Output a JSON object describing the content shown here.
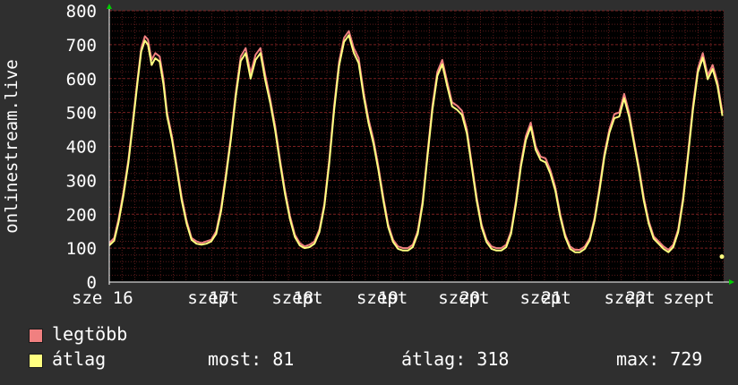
{
  "chart_data": {
    "type": "line",
    "ylabel": "onlinestream.live",
    "ylim": [
      0,
      800
    ],
    "yticks": [
      0,
      100,
      200,
      300,
      400,
      500,
      600,
      700,
      800
    ],
    "xlim": [
      0,
      100
    ],
    "xticks": [
      {
        "x": 3.6,
        "label": "sze 16"
      },
      {
        "x": 16.9,
        "label": "szept"
      },
      {
        "x": 17.9,
        "label": "17"
      },
      {
        "x": 30.6,
        "label": "szept"
      },
      {
        "x": 31.6,
        "label": "18"
      },
      {
        "x": 44.4,
        "label": "szept"
      },
      {
        "x": 45.4,
        "label": "19"
      },
      {
        "x": 57.7,
        "label": "szept"
      },
      {
        "x": 58.7,
        "label": "20"
      },
      {
        "x": 71.0,
        "label": "szept"
      },
      {
        "x": 72.0,
        "label": "21"
      },
      {
        "x": 84.7,
        "label": "szept"
      },
      {
        "x": 85.7,
        "label": "22"
      },
      {
        "x": 98.5,
        "label": "szept"
      }
    ],
    "grid": true,
    "colors": {
      "background": "#000000",
      "outer": "#2f2f2f",
      "grid": "#5a1a1a",
      "axis": "#ffffff",
      "max_series": "#f08080",
      "avg_series": "#ffff80",
      "arrow": "#00cc00"
    },
    "series": [
      {
        "name": "legtöbb",
        "color": "#f08080",
        "points": [
          [
            0,
            115
          ],
          [
            0.8,
            130
          ],
          [
            1.5,
            185
          ],
          [
            2.3,
            265
          ],
          [
            3.1,
            360
          ],
          [
            3.8,
            470
          ],
          [
            4.6,
            600
          ],
          [
            5.2,
            690
          ],
          [
            5.8,
            725
          ],
          [
            6.3,
            715
          ],
          [
            6.9,
            655
          ],
          [
            7.5,
            675
          ],
          [
            8.2,
            665
          ],
          [
            8.8,
            600
          ],
          [
            9.4,
            500
          ],
          [
            10.2,
            430
          ],
          [
            11,
            340
          ],
          [
            11.8,
            250
          ],
          [
            12.6,
            180
          ],
          [
            13.4,
            130
          ],
          [
            14.2,
            120
          ],
          [
            15,
            115
          ],
          [
            15.8,
            120
          ],
          [
            16.6,
            125
          ],
          [
            17.4,
            150
          ],
          [
            18.2,
            220
          ],
          [
            19,
            320
          ],
          [
            19.8,
            430
          ],
          [
            20.6,
            560
          ],
          [
            21.4,
            665
          ],
          [
            22.2,
            690
          ],
          [
            23,
            615
          ],
          [
            23.8,
            670
          ],
          [
            24.6,
            690
          ],
          [
            25.4,
            610
          ],
          [
            26.2,
            540
          ],
          [
            27,
            460
          ],
          [
            27.8,
            360
          ],
          [
            28.6,
            270
          ],
          [
            29.4,
            195
          ],
          [
            30.2,
            140
          ],
          [
            31,
            115
          ],
          [
            31.8,
            105
          ],
          [
            32.6,
            110
          ],
          [
            33.4,
            120
          ],
          [
            34.2,
            155
          ],
          [
            35,
            230
          ],
          [
            35.8,
            360
          ],
          [
            36.6,
            520
          ],
          [
            37.4,
            650
          ],
          [
            38.2,
            720
          ],
          [
            39,
            740
          ],
          [
            39.8,
            690
          ],
          [
            40.6,
            660
          ],
          [
            41.4,
            560
          ],
          [
            42.2,
            480
          ],
          [
            43,
            420
          ],
          [
            43.8,
            340
          ],
          [
            44.6,
            250
          ],
          [
            45.4,
            170
          ],
          [
            46.2,
            125
          ],
          [
            47,
            105
          ],
          [
            47.8,
            100
          ],
          [
            48.6,
            100
          ],
          [
            49.4,
            110
          ],
          [
            50.2,
            150
          ],
          [
            51,
            240
          ],
          [
            51.8,
            380
          ],
          [
            52.6,
            520
          ],
          [
            53.4,
            620
          ],
          [
            54.2,
            655
          ],
          [
            55,
            590
          ],
          [
            55.8,
            530
          ],
          [
            56.6,
            520
          ],
          [
            57.4,
            505
          ],
          [
            58.2,
            450
          ],
          [
            59,
            350
          ],
          [
            59.8,
            250
          ],
          [
            60.6,
            170
          ],
          [
            61.4,
            125
          ],
          [
            62.2,
            105
          ],
          [
            63,
            100
          ],
          [
            63.8,
            100
          ],
          [
            64.6,
            110
          ],
          [
            65.4,
            150
          ],
          [
            66.2,
            240
          ],
          [
            67,
            350
          ],
          [
            67.8,
            430
          ],
          [
            68.6,
            470
          ],
          [
            69.4,
            400
          ],
          [
            70.2,
            370
          ],
          [
            71,
            365
          ],
          [
            71.8,
            330
          ],
          [
            72.6,
            280
          ],
          [
            73.4,
            200
          ],
          [
            74.2,
            140
          ],
          [
            75,
            105
          ],
          [
            75.8,
            95
          ],
          [
            76.6,
            95
          ],
          [
            77.4,
            105
          ],
          [
            78.2,
            130
          ],
          [
            79,
            190
          ],
          [
            79.8,
            280
          ],
          [
            80.6,
            380
          ],
          [
            81.4,
            450
          ],
          [
            82.2,
            495
          ],
          [
            83,
            500
          ],
          [
            83.8,
            555
          ],
          [
            84.6,
            500
          ],
          [
            85.4,
            420
          ],
          [
            86.2,
            340
          ],
          [
            87,
            250
          ],
          [
            87.8,
            180
          ],
          [
            88.6,
            135
          ],
          [
            89.4,
            120
          ],
          [
            90.2,
            105
          ],
          [
            91,
            95
          ],
          [
            91.8,
            110
          ],
          [
            92.6,
            155
          ],
          [
            93.4,
            250
          ],
          [
            94.2,
            380
          ],
          [
            95,
            520
          ],
          [
            95.8,
            630
          ],
          [
            96.6,
            675
          ],
          [
            97.4,
            610
          ],
          [
            98.2,
            640
          ],
          [
            99,
            590
          ],
          [
            99.8,
            500
          ]
        ]
      },
      {
        "name": "átlag",
        "color": "#ffff80",
        "points": [
          [
            0,
            108
          ],
          [
            0.8,
            122
          ],
          [
            1.5,
            175
          ],
          [
            2.3,
            255
          ],
          [
            3.1,
            350
          ],
          [
            3.8,
            460
          ],
          [
            4.6,
            590
          ],
          [
            5.2,
            680
          ],
          [
            5.8,
            712
          ],
          [
            6.3,
            700
          ],
          [
            6.9,
            640
          ],
          [
            7.5,
            660
          ],
          [
            8.2,
            650
          ],
          [
            8.8,
            585
          ],
          [
            9.4,
            490
          ],
          [
            10.2,
            420
          ],
          [
            11,
            330
          ],
          [
            11.8,
            240
          ],
          [
            12.6,
            172
          ],
          [
            13.4,
            124
          ],
          [
            14.2,
            113
          ],
          [
            15,
            110
          ],
          [
            15.8,
            113
          ],
          [
            16.6,
            120
          ],
          [
            17.4,
            142
          ],
          [
            18.2,
            210
          ],
          [
            19,
            310
          ],
          [
            19.8,
            420
          ],
          [
            20.6,
            548
          ],
          [
            21.4,
            652
          ],
          [
            22.2,
            675
          ],
          [
            23,
            600
          ],
          [
            23.8,
            655
          ],
          [
            24.6,
            675
          ],
          [
            25.4,
            595
          ],
          [
            26.2,
            528
          ],
          [
            27,
            448
          ],
          [
            27.8,
            350
          ],
          [
            28.6,
            260
          ],
          [
            29.4,
            186
          ],
          [
            30.2,
            133
          ],
          [
            31,
            108
          ],
          [
            31.8,
            100
          ],
          [
            32.6,
            103
          ],
          [
            33.4,
            113
          ],
          [
            34.2,
            147
          ],
          [
            35,
            222
          ],
          [
            35.8,
            350
          ],
          [
            36.6,
            508
          ],
          [
            37.4,
            638
          ],
          [
            38.2,
            708
          ],
          [
            39,
            728
          ],
          [
            39.8,
            676
          ],
          [
            40.6,
            645
          ],
          [
            41.4,
            548
          ],
          [
            42.2,
            468
          ],
          [
            43,
            408
          ],
          [
            43.8,
            330
          ],
          [
            44.6,
            240
          ],
          [
            45.4,
            162
          ],
          [
            46.2,
            118
          ],
          [
            47,
            98
          ],
          [
            47.8,
            93
          ],
          [
            48.6,
            93
          ],
          [
            49.4,
            103
          ],
          [
            50.2,
            142
          ],
          [
            51,
            230
          ],
          [
            51.8,
            370
          ],
          [
            52.6,
            508
          ],
          [
            53.4,
            608
          ],
          [
            54.2,
            642
          ],
          [
            55,
            578
          ],
          [
            55.8,
            518
          ],
          [
            56.6,
            508
          ],
          [
            57.4,
            493
          ],
          [
            58.2,
            438
          ],
          [
            59,
            340
          ],
          [
            59.8,
            240
          ],
          [
            60.6,
            162
          ],
          [
            61.4,
            118
          ],
          [
            62.2,
            98
          ],
          [
            63,
            93
          ],
          [
            63.8,
            93
          ],
          [
            64.6,
            103
          ],
          [
            65.4,
            142
          ],
          [
            66.2,
            230
          ],
          [
            67,
            340
          ],
          [
            67.8,
            418
          ],
          [
            68.6,
            458
          ],
          [
            69.4,
            390
          ],
          [
            70.2,
            360
          ],
          [
            71,
            353
          ],
          [
            71.8,
            320
          ],
          [
            72.6,
            270
          ],
          [
            73.4,
            192
          ],
          [
            74.2,
            133
          ],
          [
            75,
            98
          ],
          [
            75.8,
            88
          ],
          [
            76.6,
            88
          ],
          [
            77.4,
            98
          ],
          [
            78.2,
            123
          ],
          [
            79,
            182
          ],
          [
            79.8,
            270
          ],
          [
            80.6,
            370
          ],
          [
            81.4,
            440
          ],
          [
            82.2,
            483
          ],
          [
            83,
            488
          ],
          [
            83.8,
            542
          ],
          [
            84.6,
            488
          ],
          [
            85.4,
            410
          ],
          [
            86.2,
            330
          ],
          [
            87,
            240
          ],
          [
            87.8,
            172
          ],
          [
            88.6,
            128
          ],
          [
            89.4,
            113
          ],
          [
            90.2,
            98
          ],
          [
            91,
            88
          ],
          [
            91.8,
            103
          ],
          [
            92.6,
            147
          ],
          [
            93.4,
            240
          ],
          [
            94.2,
            370
          ],
          [
            95,
            508
          ],
          [
            95.8,
            618
          ],
          [
            96.6,
            662
          ],
          [
            97.4,
            598
          ],
          [
            98.2,
            628
          ],
          [
            99,
            578
          ],
          [
            99.8,
            490
          ]
        ]
      }
    ],
    "end_point": {
      "x": 100,
      "y": 75
    }
  },
  "legend": {
    "max_label": "legtöbb",
    "avg_label": "átlag",
    "now_label": "most: 81",
    "avg_stat_label": "átlag: 318",
    "max_stat_label": "max: 729"
  }
}
